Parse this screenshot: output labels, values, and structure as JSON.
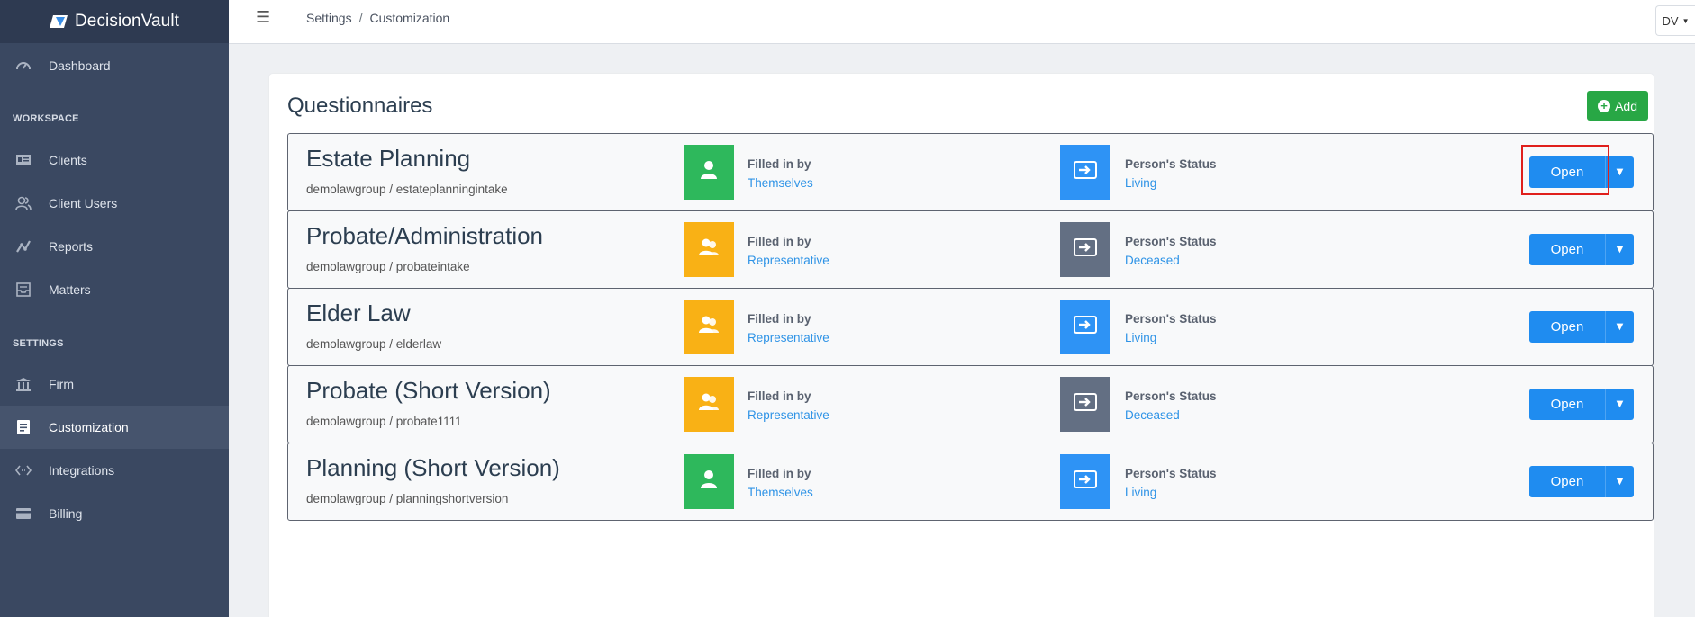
{
  "app": {
    "name": "DecisionVault"
  },
  "sidebar": {
    "items": [
      {
        "label": "Dashboard",
        "icon": "gauge-icon"
      },
      {
        "label": "Clients",
        "icon": "id-card-icon"
      },
      {
        "label": "Client Users",
        "icon": "users-icon"
      },
      {
        "label": "Reports",
        "icon": "chart-line-icon"
      },
      {
        "label": "Matters",
        "icon": "inbox-icon"
      },
      {
        "label": "Firm",
        "icon": "bank-icon"
      },
      {
        "label": "Customization",
        "icon": "file-text-icon",
        "active": true
      },
      {
        "label": "Integrations",
        "icon": "code-icon"
      },
      {
        "label": "Billing",
        "icon": "credit-card-icon"
      }
    ],
    "sections": {
      "workspace": "WORKSPACE",
      "settings": "SETTINGS"
    }
  },
  "topbar": {
    "menu_icon": "☰",
    "breadcrumb": [
      "Settings",
      "Customization"
    ],
    "breadcrumb_sep": "/",
    "user_initials": "DV"
  },
  "main": {
    "title": "Questionnaires",
    "add_label": "Add",
    "filled_label": "Filled in by",
    "status_label": "Person's Status",
    "open_label": "Open",
    "questionnaires": [
      {
        "title": "Estate Planning",
        "path": "demolawgroup / estateplanningintake",
        "filled_by": "Themselves",
        "status": "Living",
        "filled_color": "#2eb85c",
        "status_color": "#2e93f5"
      },
      {
        "title": "Probate/Administration",
        "path": "demolawgroup / probateintake",
        "filled_by": "Representative",
        "status": "Deceased",
        "filled_color": "#f9b115",
        "status_color": "#636f83"
      },
      {
        "title": "Elder Law",
        "path": "demolawgroup / elderlaw",
        "filled_by": "Representative",
        "status": "Living",
        "filled_color": "#f9b115",
        "status_color": "#2e93f5"
      },
      {
        "title": "Probate (Short Version)",
        "path": "demolawgroup / probate1111",
        "filled_by": "Representative",
        "status": "Deceased",
        "filled_color": "#f9b115",
        "status_color": "#636f83"
      },
      {
        "title": "Planning (Short Version)",
        "path": "demolawgroup / planningshortversion",
        "filled_by": "Themselves",
        "status": "Living",
        "filled_color": "#2eb85c",
        "status_color": "#2e93f5"
      }
    ]
  }
}
